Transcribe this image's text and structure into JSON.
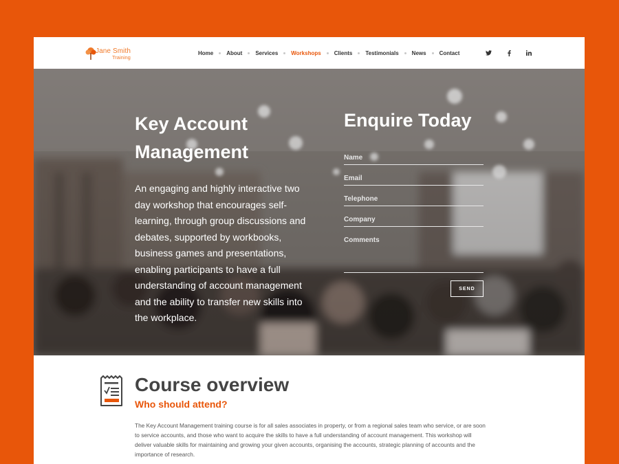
{
  "brand": {
    "name": "Jane Smith",
    "sub": "Training",
    "accent": "#e8560a"
  },
  "nav": {
    "items": [
      {
        "label": "Home",
        "active": false
      },
      {
        "label": "About",
        "active": false
      },
      {
        "label": "Services",
        "active": false
      },
      {
        "label": "Workshops",
        "active": true
      },
      {
        "label": "Clients",
        "active": false
      },
      {
        "label": "Testimonials",
        "active": false
      },
      {
        "label": "News",
        "active": false
      },
      {
        "label": "Contact",
        "active": false
      }
    ],
    "social": [
      "twitter-icon",
      "facebook-icon",
      "linkedin-icon"
    ]
  },
  "hero": {
    "title_line1": "Key Account",
    "title_line2": "Management",
    "description": "An engaging and highly interactive two day workshop that encourages self-learning, through group discussions and debates, supported by workbooks, business games and presentations, enabling participants to have a full understanding of account management and the ability to transfer new skills into the workplace."
  },
  "enquiry": {
    "title": "Enquire Today",
    "name_placeholder": "Name",
    "email_placeholder": "Email",
    "telephone_placeholder": "Telephone",
    "company_placeholder": "Company",
    "comments_placeholder": "Comments",
    "send_label": "SEND"
  },
  "overview": {
    "title": "Course overview",
    "subtitle": "Who should attend?",
    "body": "The Key Account Management training course is for all sales associates in property, or from a regional sales team who service, or are soon to service accounts, and those who want to acquire the skills to have a full understanding of account management. This workshop will deliver valuable skills for maintaining and growing your given accounts, organising the accounts, strategic planning of accounts and the importance of research."
  }
}
